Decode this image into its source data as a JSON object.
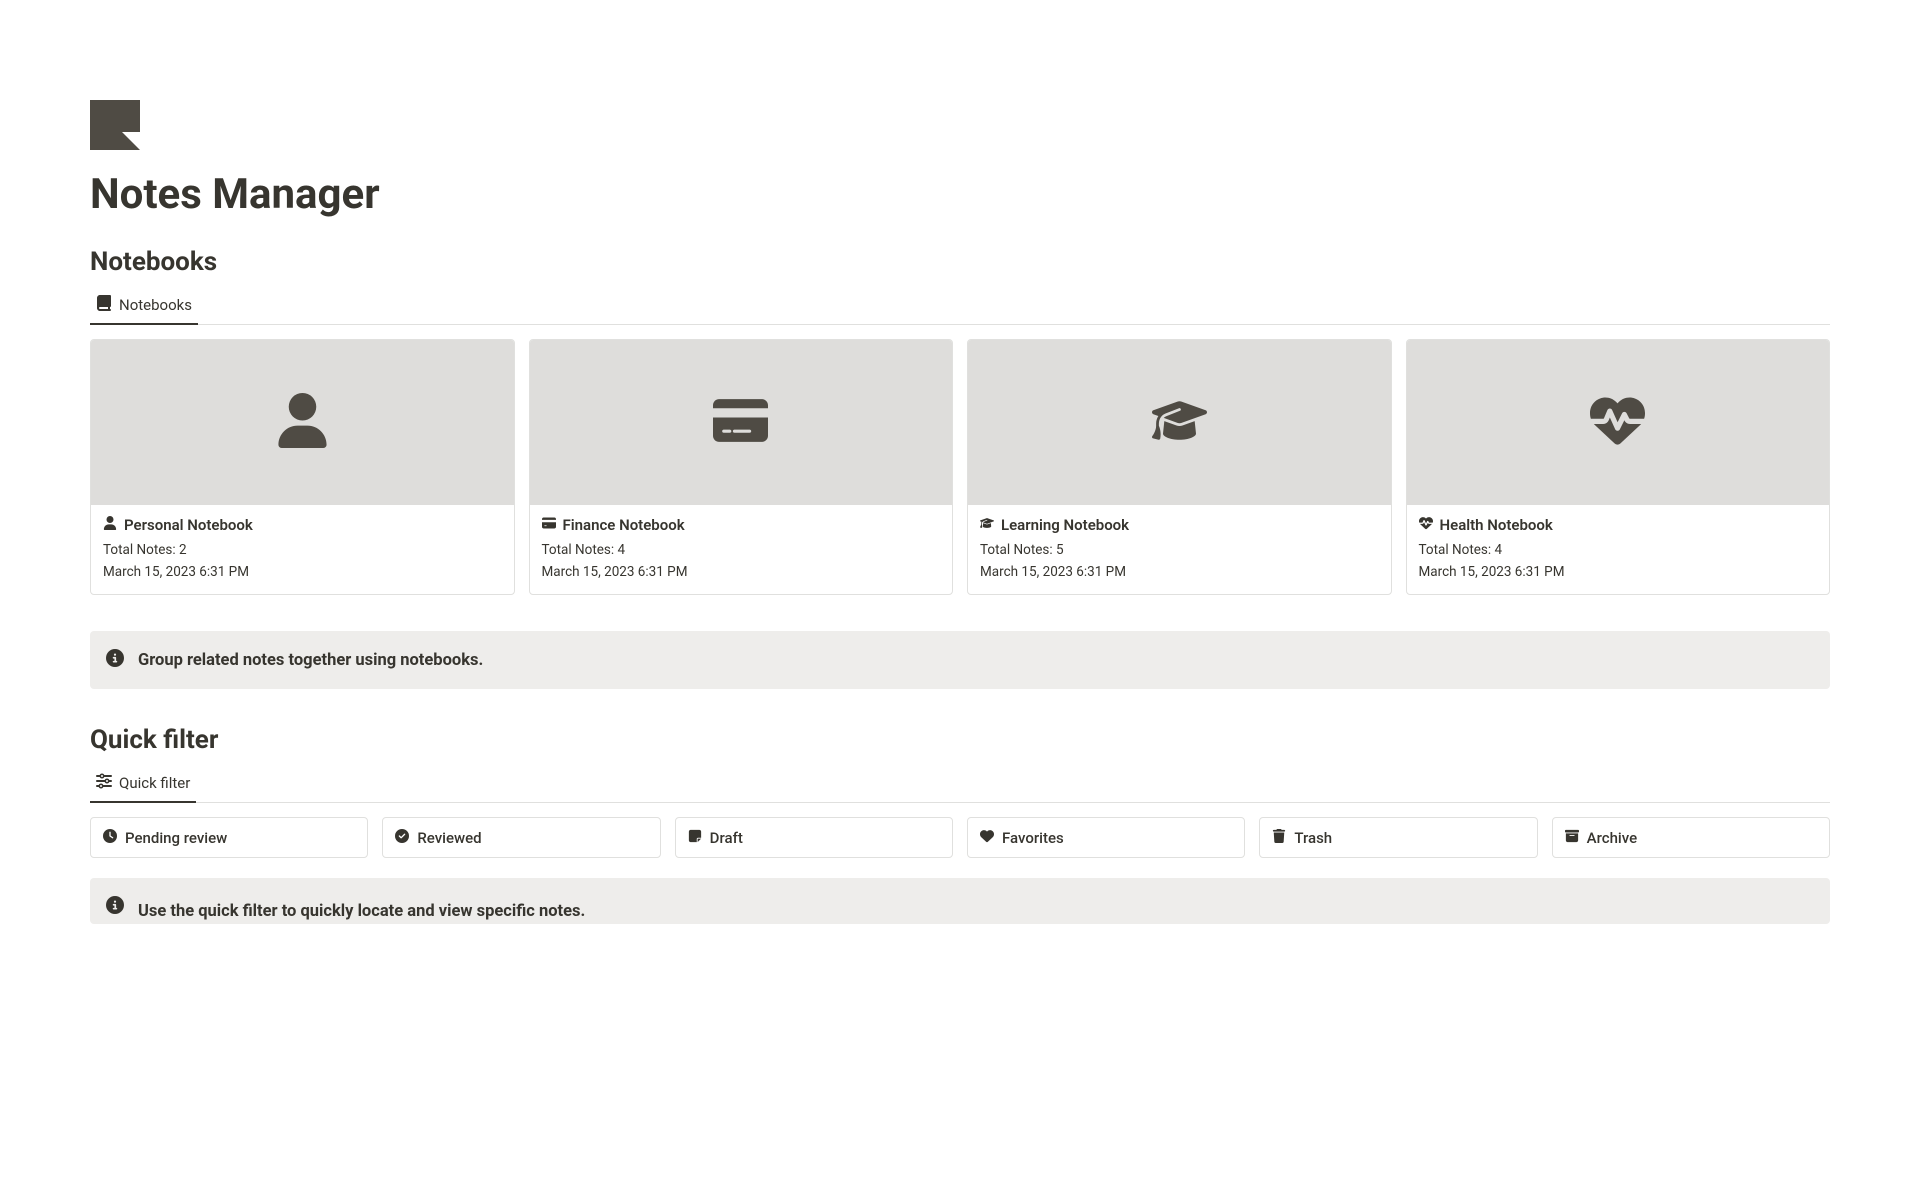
{
  "page": {
    "title": "Notes Manager"
  },
  "notebooks_section": {
    "heading": "Notebooks",
    "tab_label": "Notebooks",
    "info_text": "Group related notes together using notebooks.",
    "cards": [
      {
        "icon": "person",
        "title": "Personal Notebook",
        "total_label": "Total Notes: 2",
        "date": "March 15, 2023 6:31 PM"
      },
      {
        "icon": "credit-card",
        "title": "Finance Notebook",
        "total_label": "Total Notes: 4",
        "date": "March 15, 2023 6:31 PM"
      },
      {
        "icon": "graduation-cap",
        "title": "Learning Notebook",
        "total_label": "Total Notes: 5",
        "date": "March 15, 2023 6:31 PM"
      },
      {
        "icon": "heart-pulse",
        "title": "Health Notebook",
        "total_label": "Total Notes: 4",
        "date": "March 15, 2023 6:31 PM"
      }
    ]
  },
  "quick_filter_section": {
    "heading": "Quick filter",
    "tab_label": "Quick filter",
    "info_text": "Use the quick filter to quickly locate and view specific notes.",
    "filters": [
      {
        "icon": "clock",
        "label": "Pending review"
      },
      {
        "icon": "check-circle",
        "label": "Reviewed"
      },
      {
        "icon": "note-sticky",
        "label": "Draft"
      },
      {
        "icon": "heart",
        "label": "Favorites"
      },
      {
        "icon": "trash",
        "label": "Trash"
      },
      {
        "icon": "box-archive",
        "label": "Archive"
      }
    ]
  }
}
